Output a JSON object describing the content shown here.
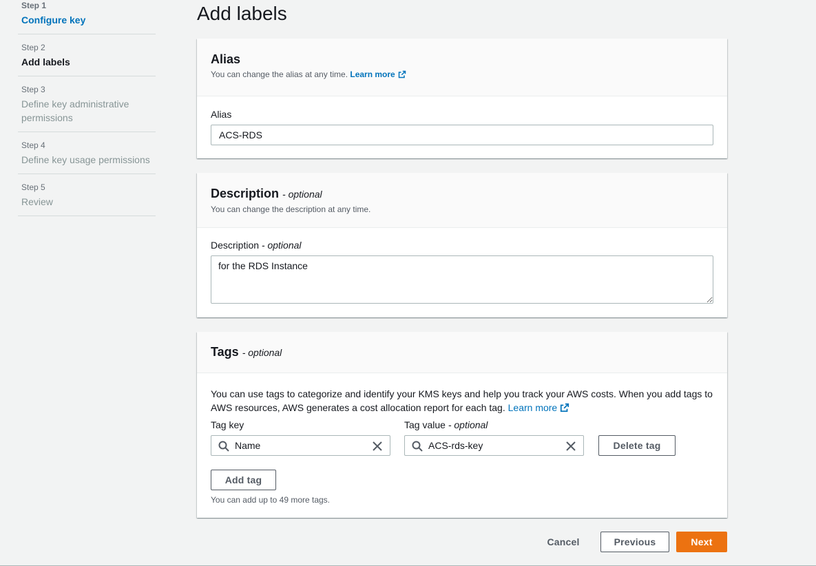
{
  "steps": [
    {
      "number": "Step 1",
      "label": "Configure key"
    },
    {
      "number": "Step 2",
      "label": "Add labels"
    },
    {
      "number": "Step 3",
      "label": "Define key administrative permissions"
    },
    {
      "number": "Step 4",
      "label": "Define key usage permissions"
    },
    {
      "number": "Step 5",
      "label": "Review"
    }
  ],
  "page_title": "Add labels",
  "alias_panel": {
    "title": "Alias",
    "description": "You can change the alias at any time.",
    "learn_more": "Learn more",
    "field_label": "Alias",
    "value": "ACS-RDS"
  },
  "description_panel": {
    "title": "Description",
    "optional": "- optional",
    "description": "You can change the description at any time.",
    "field_label": "Description",
    "field_optional": "- optional",
    "value": "for the RDS Instance"
  },
  "tags_panel": {
    "title": "Tags",
    "optional": "- optional",
    "info_text": "You can use tags to categorize and identify your KMS keys and help you track your AWS costs. When you add tags to AWS resources, AWS generates a cost allocation report for each tag.",
    "learn_more": "Learn more",
    "tag_key_label": "Tag key",
    "tag_value_label": "Tag value",
    "tag_value_optional": "- optional",
    "tags": [
      {
        "key": "Name",
        "value": "ACS-rds-key"
      }
    ],
    "delete_tag_label": "Delete tag",
    "add_tag_label": "Add tag",
    "remaining_hint": "You can add up to 49 more tags."
  },
  "footer": {
    "cancel_label": "Cancel",
    "previous_label": "Previous",
    "next_label": "Next"
  },
  "colors": {
    "accent": "#ec7211",
    "link": "#0073bb",
    "background": "#f2f3f3"
  },
  "icons": {
    "external_link": "external-link-icon",
    "search": "search-icon",
    "clear": "close-icon"
  }
}
